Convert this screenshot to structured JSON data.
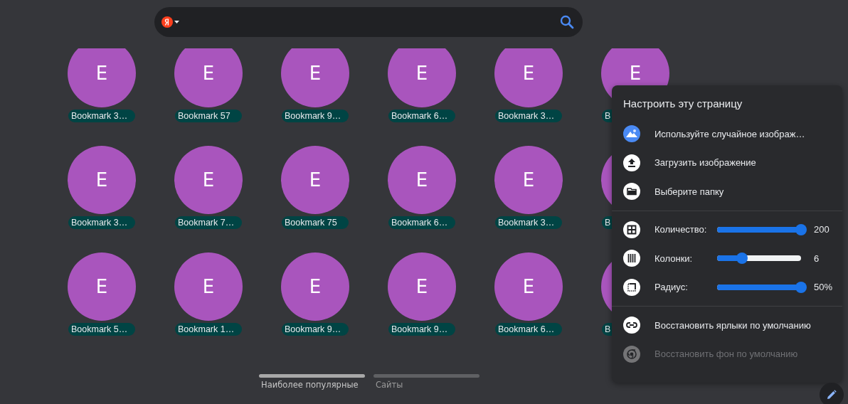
{
  "tile_rows": [
    [
      {
        "letter": "E",
        "label": "Bookmark 3…"
      },
      {
        "letter": "E",
        "label": "Bookmark 57"
      },
      {
        "letter": "E",
        "label": "Bookmark 9…"
      },
      {
        "letter": "E",
        "label": "Bookmark 6…"
      },
      {
        "letter": "E",
        "label": "Bookmark 3…"
      },
      {
        "letter": "E",
        "label": "B"
      }
    ],
    [
      {
        "letter": "E",
        "label": "Bookmark 3…"
      },
      {
        "letter": "E",
        "label": "Bookmark 7…"
      },
      {
        "letter": "E",
        "label": "Bookmark 75"
      },
      {
        "letter": "E",
        "label": "Bookmark 6…"
      },
      {
        "letter": "E",
        "label": "Bookmark 3…"
      },
      {
        "label": "B"
      }
    ],
    [
      {
        "letter": "E",
        "label": "Bookmark 5…"
      },
      {
        "letter": "E",
        "label": "Bookmark 1…"
      },
      {
        "letter": "E",
        "label": "Bookmark 9…"
      },
      {
        "letter": "E",
        "label": "Bookmark 9…"
      },
      {
        "letter": "E",
        "label": "Bookmark 6…"
      },
      {
        "label": "B"
      }
    ]
  ],
  "tabs": [
    {
      "label": "Наиболее популярные",
      "selected": true
    },
    {
      "label": "Сайты",
      "selected": false
    }
  ],
  "panel": {
    "title": "Настроить эту страницу",
    "options": [
      {
        "label": "Используйте случайное изображ…",
        "disabled": false
      },
      {
        "label": "Загрузить изображение",
        "disabled": false
      },
      {
        "label": "Выберите папку",
        "disabled": false
      }
    ],
    "sliders": [
      {
        "label": "Количество:",
        "level": 1,
        "reading": "200"
      },
      {
        "label": "Колонки:",
        "level": 0.3,
        "reading": "6"
      },
      {
        "label": "Радиус:",
        "level": 1,
        "reading": "50%"
      }
    ],
    "resets": [
      {
        "label": "Восстановить ярлыки по умолчанию",
        "disabled": false
      },
      {
        "label": "Восстановить фон по умолчанию",
        "disabled": true
      }
    ]
  }
}
